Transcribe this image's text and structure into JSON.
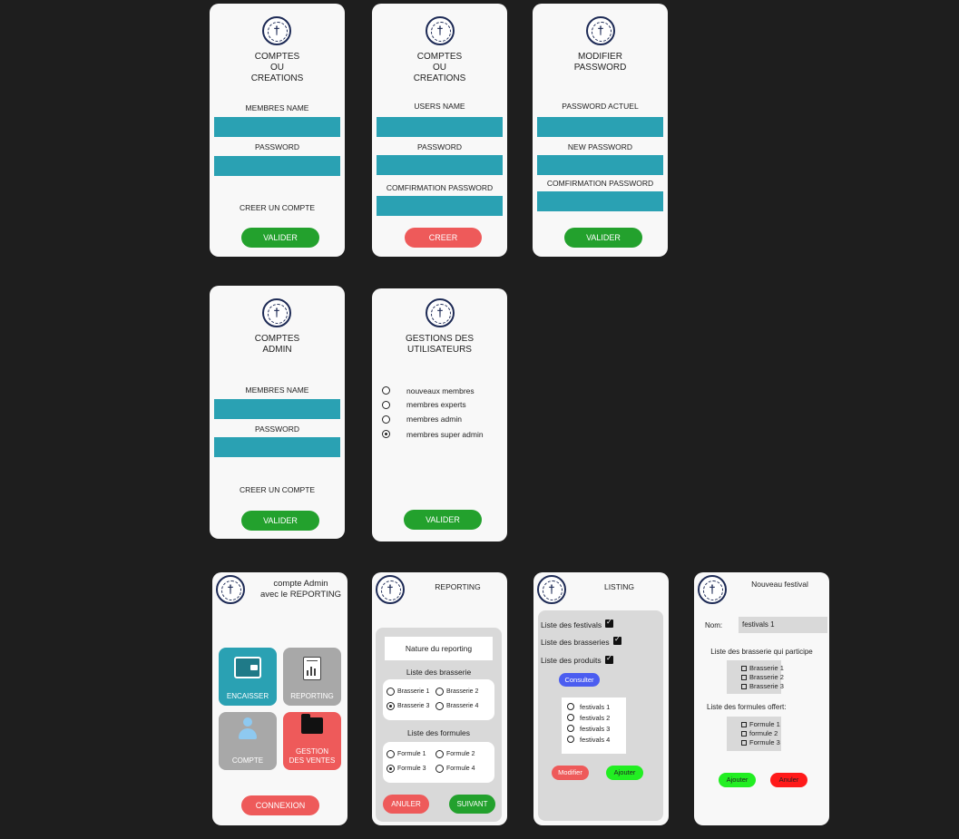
{
  "screens": {
    "login": {
      "title": "COMPTES\nOU\nCREATIONS",
      "user_label": "MEMBRES NAME",
      "pass_label": "PASSWORD",
      "create_link": "CREER UN COMPTE",
      "submit": "VALIDER"
    },
    "signup": {
      "title": "COMPTES\nOU\nCREATIONS",
      "user_label": "USERS NAME",
      "pass_label": "PASSWORD",
      "confirm_label": "COMFIRMATION PASSWORD",
      "submit": "CREER"
    },
    "change_password": {
      "title": "MODIFIER\nPASSWORD",
      "current_label": "PASSWORD ACTUEL",
      "new_label": "NEW PASSWORD",
      "confirm_label": "COMFIRMATION PASSWORD",
      "submit": "VALIDER"
    },
    "admin_login": {
      "title": "COMPTES\nADMIN",
      "user_label": "MEMBRES NAME",
      "pass_label": "PASSWORD",
      "create_link": "CREER UN COMPTE",
      "submit": "VALIDER"
    },
    "user_management": {
      "title": "GESTIONS DES\nUTILISATEURS",
      "options": [
        {
          "label": "nouveaux membres",
          "selected": false
        },
        {
          "label": "membres experts",
          "selected": false
        },
        {
          "label": "membres admin",
          "selected": false
        },
        {
          "label": "membres super admin",
          "selected": true
        }
      ],
      "submit": "VALIDER"
    },
    "admin_dashboard": {
      "title": "compte Admin\navec le REPORTING",
      "tiles": [
        {
          "label": "ENCAISSER",
          "icon": "wallet-icon",
          "color": "#2aa1b3"
        },
        {
          "label": "REPORTING",
          "icon": "report-icon",
          "color": "#a8a8a8"
        },
        {
          "label": "COMPTE",
          "icon": "user-icon",
          "color": "#a8a8a8"
        },
        {
          "label": "GESTION\nDES VENTES",
          "icon": "folder-icon",
          "color": "#ee5a5a"
        }
      ],
      "submit": "CONNEXION"
    },
    "reporting": {
      "title": "REPORTING",
      "nature_label": "Nature du reporting",
      "brasserie_label": "Liste des brasserie",
      "brasseries": [
        {
          "label": "Brasserie 1",
          "selected": false
        },
        {
          "label": "Brasserie 2",
          "selected": false
        },
        {
          "label": "Brasserie 3",
          "selected": true
        },
        {
          "label": "Brasserie 4",
          "selected": false
        }
      ],
      "formules_label": "Liste des formules",
      "formules": [
        {
          "label": "Formule 1",
          "selected": false
        },
        {
          "label": "Formule 2",
          "selected": false
        },
        {
          "label": "Formule 3",
          "selected": true
        },
        {
          "label": "Formule 4",
          "selected": false
        }
      ],
      "cancel": "ANULER",
      "next": "SUIVANT"
    },
    "listing": {
      "title": "LISTING",
      "checks": [
        "Liste des festivals",
        "Liste des brasseries",
        "Liste des produits"
      ],
      "consult": "Consulter",
      "festivals": [
        "festivals 1",
        "festivals 2",
        "festivals 3",
        "festivals 4"
      ],
      "modify": "Modifier",
      "add": "Ajouter"
    },
    "new_festival": {
      "title": "Nouveau festival",
      "name_label": "Nom:",
      "name_value": "festivals 1",
      "brasserie_label": "Liste des brasserie qui participe",
      "brasseries": [
        "Brasserie 1",
        "Brasserie 2",
        "Brasserie 3"
      ],
      "formules_label": "Liste des formules offert:",
      "formules": [
        "Formule 1",
        "formule 2",
        "Formule 3"
      ],
      "add": "Ajouter",
      "cancel": "Anuler"
    }
  },
  "colors": {
    "teal": "#2aa1b3",
    "green": "#23a12d",
    "red": "#ee5a5a",
    "blue": "#4b5df0",
    "lime": "#22ee22",
    "bright_red": "#ff1a1a"
  }
}
